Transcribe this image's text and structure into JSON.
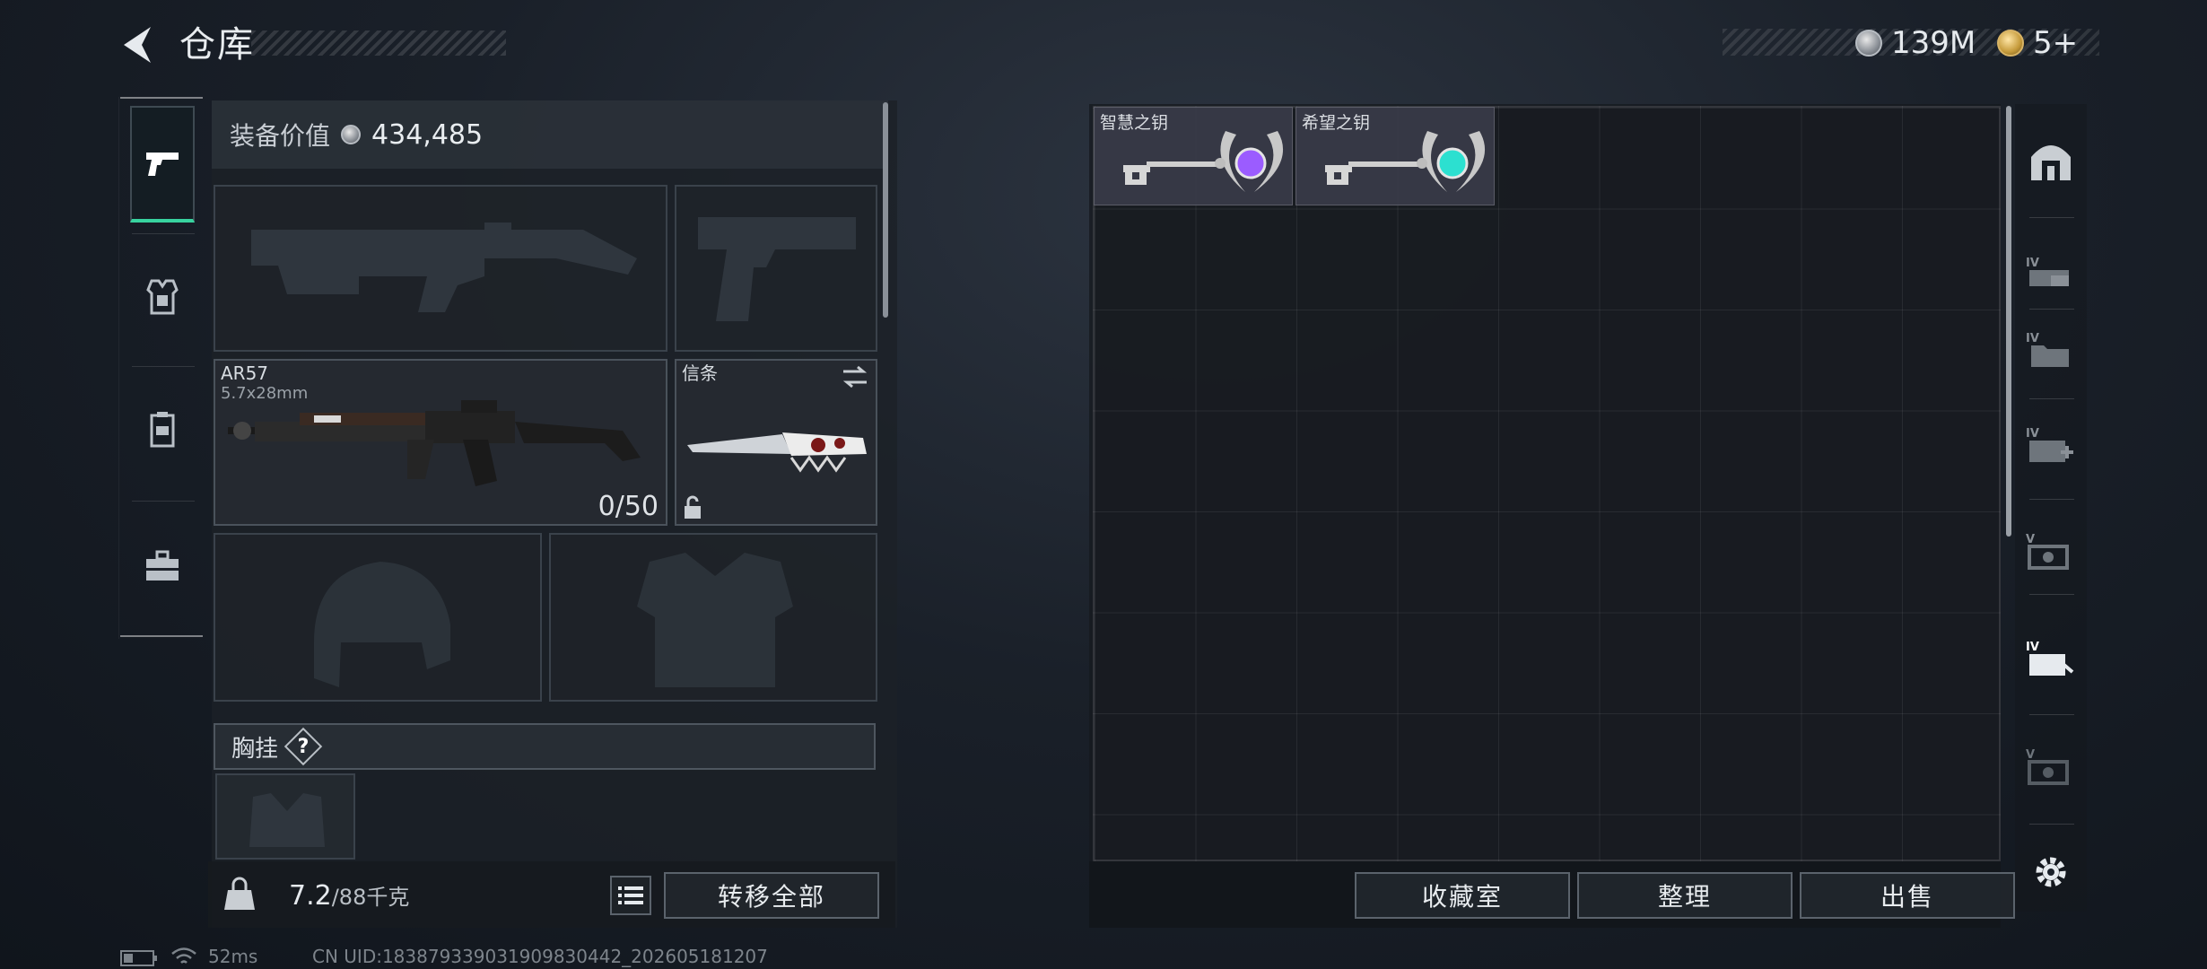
{
  "header": {
    "title": "仓库"
  },
  "currencies": [
    {
      "icon": "silver-coin-icon",
      "value": "139M"
    },
    {
      "icon": "gold-coin-icon",
      "value": "5+"
    }
  ],
  "equipment": {
    "value_label": "装备价值",
    "value": "434,485",
    "weapon": {
      "name": "AR57",
      "ammo_type": "5.7x28mm",
      "ammo": "0/50"
    },
    "melee": {
      "name": "信条"
    },
    "chest_rig_label": "胸挂",
    "help_mark": "?"
  },
  "footer": {
    "weight": "7.2",
    "capacity": "/88千克",
    "transfer_all": "转移全部"
  },
  "storage": {
    "items": [
      {
        "name": "智慧之钥",
        "gem_color": "#9b5cff"
      },
      {
        "name": "希望之钥",
        "gem_color": "#2ce0d0"
      }
    ],
    "buttons": {
      "collection": "收藏室",
      "sort": "整理",
      "sell": "出售"
    }
  },
  "right_tabs": [
    "",
    "IV",
    "IV",
    "IV",
    "V",
    "IV",
    "V"
  ],
  "status": {
    "ping": "52ms",
    "uid": "CN UID:18387933903190983044​2_202605181207"
  },
  "colors": {
    "accent": "#38d39f"
  }
}
